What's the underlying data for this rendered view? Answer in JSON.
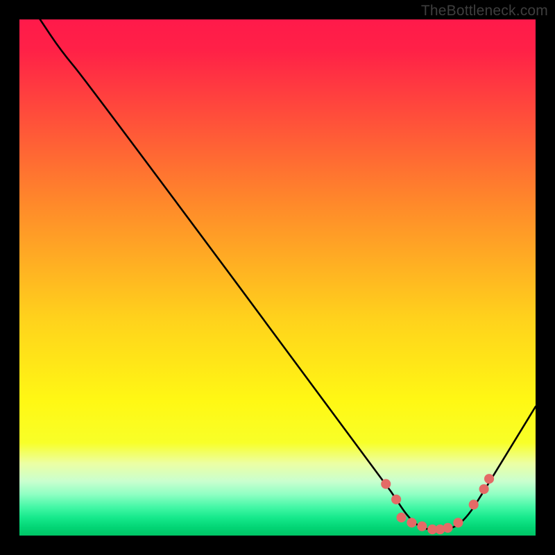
{
  "watermark": "TheBottleneck.com",
  "chart_data": {
    "type": "line",
    "title": "",
    "xlabel": "",
    "ylabel": "",
    "xlim": [
      0,
      100
    ],
    "ylim": [
      0,
      100
    ],
    "series": [
      {
        "name": "bottleneck-curve",
        "x": [
          4,
          8,
          13,
          71,
          73,
          75,
          77,
          79,
          81,
          83,
          85,
          87,
          89,
          100
        ],
        "y": [
          100,
          94,
          88,
          10,
          7,
          4,
          2,
          1.2,
          1,
          1.2,
          2,
          4,
          7,
          25
        ]
      }
    ],
    "markers": {
      "name": "highlight-points",
      "color": "#e46a66",
      "x": [
        71,
        73,
        74,
        76,
        78,
        80,
        81.5,
        83,
        85,
        88,
        90,
        91
      ],
      "y": [
        10,
        7,
        3.5,
        2.5,
        1.8,
        1.2,
        1.2,
        1.5,
        2.5,
        6,
        9,
        11
      ]
    },
    "background": {
      "type": "vertical-gradient",
      "stops": [
        {
          "pos": 0.0,
          "color": "#ff1a4a"
        },
        {
          "pos": 0.06,
          "color": "#ff2147"
        },
        {
          "pos": 0.36,
          "color": "#ff8a2a"
        },
        {
          "pos": 0.58,
          "color": "#ffd21c"
        },
        {
          "pos": 0.74,
          "color": "#fff814"
        },
        {
          "pos": 0.82,
          "color": "#f8ff28"
        },
        {
          "pos": 0.86,
          "color": "#ecffa3"
        },
        {
          "pos": 0.895,
          "color": "#c9ffcf"
        },
        {
          "pos": 0.92,
          "color": "#8fffc3"
        },
        {
          "pos": 0.945,
          "color": "#43f7a6"
        },
        {
          "pos": 0.965,
          "color": "#16e98c"
        },
        {
          "pos": 0.985,
          "color": "#02d474"
        },
        {
          "pos": 1.0,
          "color": "#00c465"
        }
      ]
    }
  }
}
